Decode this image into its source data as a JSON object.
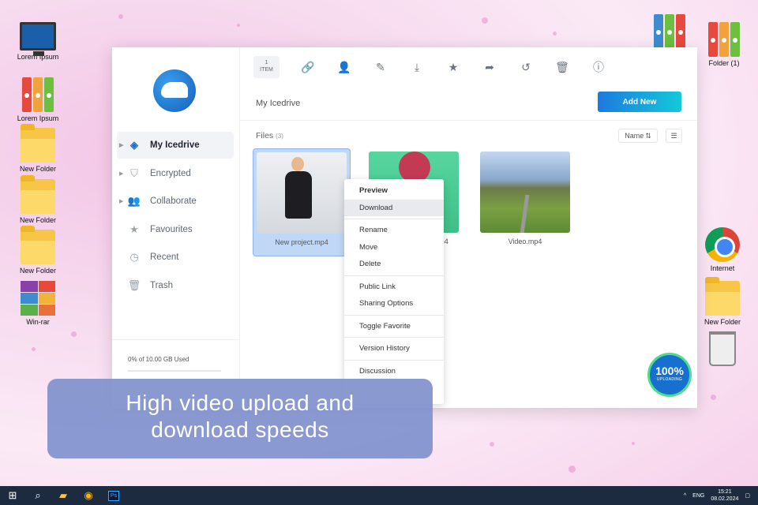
{
  "desktop": {
    "left_icons": [
      {
        "label": "Lorem Ipsum",
        "kind": "monitor"
      },
      {
        "label": "Lorem Ipsum",
        "kind": "binders"
      },
      {
        "label": "New Folder",
        "kind": "folder"
      },
      {
        "label": "New Folder",
        "kind": "folder"
      },
      {
        "label": "New Folder",
        "kind": "folder"
      },
      {
        "label": "Win-rar",
        "kind": "winrar"
      }
    ],
    "right_icons": {
      "folder1": "Folder (1)",
      "internet": "Internet",
      "new_folder": "New Folder"
    }
  },
  "sidebar": {
    "items": [
      {
        "label": "My Icedrive",
        "icon": "layers-icon",
        "active": true
      },
      {
        "label": "Encrypted",
        "icon": "shield-icon"
      },
      {
        "label": "Collaborate",
        "icon": "users-icon"
      },
      {
        "label": "Favourites",
        "icon": "star-icon"
      },
      {
        "label": "Recent",
        "icon": "clock-icon"
      },
      {
        "label": "Trash",
        "icon": "trash-icon"
      }
    ],
    "storage_text": "0% of 10.00 GB Used",
    "storage_used_fraction": 0.0
  },
  "toolbar": {
    "item_count_number": "1",
    "item_count_label": "ITEM",
    "tools": [
      "link-icon",
      "add-user-icon",
      "pencil-icon",
      "download-icon",
      "star-icon",
      "share-icon",
      "history-icon",
      "trash-icon",
      "info-icon"
    ]
  },
  "main": {
    "breadcrumb": "My Icedrive",
    "add_new_label": "Add New",
    "files_label": "Files",
    "files_count": "(3)",
    "sort_label": "Name",
    "files": [
      {
        "name": "New project.mp4",
        "selected": true
      },
      {
        "name": "mp4",
        "selected": false
      },
      {
        "name": "Video.mp4",
        "selected": false
      }
    ]
  },
  "context_menu": {
    "groups": [
      [
        "Preview",
        "Download"
      ],
      [
        "Rename",
        "Move",
        "Delete"
      ],
      [
        "Public Link",
        "Sharing Options"
      ],
      [
        "Toggle Favorite"
      ],
      [
        "Version History"
      ],
      [
        "Discussion"
      ]
    ],
    "highlighted": "Download"
  },
  "upload_badge": {
    "percent": "100%",
    "label": "UPLOADING"
  },
  "banner": {
    "line1": "High video upload and",
    "line2": "download speeds"
  },
  "taskbar": {
    "lang": "ENG",
    "time": "15:21",
    "date": "08.02.2024"
  },
  "colors": {
    "accent": "#1d7ae0",
    "accent_end": "#13c9d9",
    "banner": "#8091cd",
    "taskbar": "#1c2b3f"
  }
}
